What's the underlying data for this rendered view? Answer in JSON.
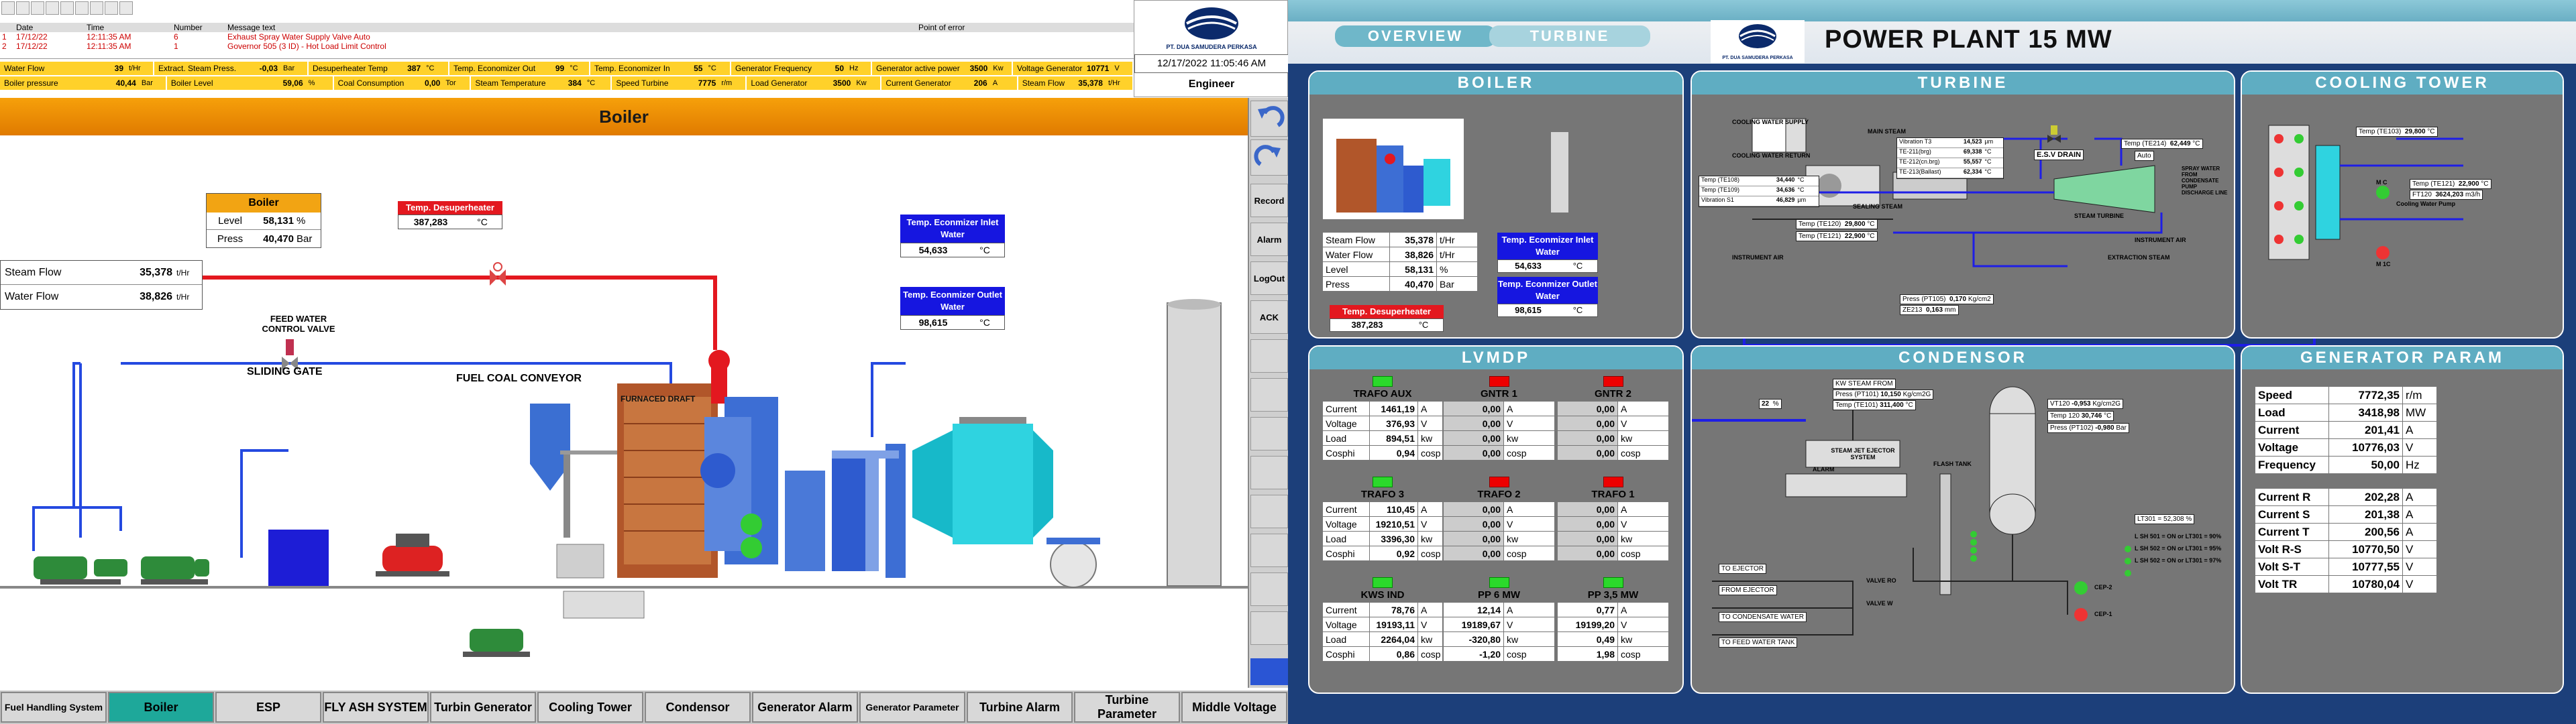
{
  "left": {
    "alarm_table": {
      "headers": [
        "",
        "Date",
        "Time",
        "Number",
        "Message text",
        "Point of error"
      ],
      "rows": [
        {
          "idx": "1",
          "date": "17/12/22",
          "time": "12:11:35 AM",
          "number": "6",
          "message": "Exhaust Spray Water Supply Valve Auto",
          "point": ""
        },
        {
          "idx": "2",
          "date": "17/12/22",
          "time": "12:11:35 AM",
          "number": "1",
          "message": "Governor 505 (3 ID) - Hot Load Limit Control",
          "point": ""
        }
      ]
    },
    "status_row1": [
      {
        "label": "Water Flow",
        "value": "39",
        "unit": "t/Hr"
      },
      {
        "label": "Extract. Steam Press.",
        "value": "-0,03",
        "unit": "Bar"
      },
      {
        "label": "Desuperheater Temp",
        "value": "387",
        "unit": "°C"
      },
      {
        "label": "Temp. Economizer Out",
        "value": "99",
        "unit": "°C"
      },
      {
        "label": "Temp. Economizer In",
        "value": "55",
        "unit": "°C"
      },
      {
        "label": "Generator Frequency",
        "value": "50",
        "unit": "Hz"
      },
      {
        "label": "Generator active power",
        "value": "3500",
        "unit": "Kw"
      },
      {
        "label": "Voltage Generator",
        "value": "10771",
        "unit": "V"
      }
    ],
    "status_row2": [
      {
        "label": "Boiler pressure",
        "value": "40,44",
        "unit": "Bar"
      },
      {
        "label": "Boiler Level",
        "value": "59,06",
        "unit": "%"
      },
      {
        "label": "Coal Consumption",
        "value": "0,00",
        "unit": "Tor"
      },
      {
        "label": "Steam Temperature",
        "value": "384",
        "unit": "°C"
      },
      {
        "label": "Speed Turbine",
        "value": "7775",
        "unit": "r/m"
      },
      {
        "label": "Load Generator",
        "value": "3500",
        "unit": "Kw"
      },
      {
        "label": "Current Generator",
        "value": "206",
        "unit": "A"
      },
      {
        "label": "Steam Flow",
        "value": "35,378",
        "unit": "t/Hr"
      }
    ],
    "datetime": "12/17/2022 11:05:46 AM",
    "user": "Engineer",
    "logo_caption": "PT. DUA SAMUDERA PERKASA",
    "page_title": "Boiler",
    "right_nav": [
      "Record",
      "Alarm",
      "LogOut",
      "ACK"
    ],
    "boiler_box": {
      "title": "Boiler",
      "level_label": "Level",
      "level_value": "58,131",
      "level_unit": "%",
      "press_label": "Press",
      "press_value": "40,470",
      "press_unit": "Bar"
    },
    "desuper": {
      "label": "Temp. Desuperheater",
      "value": "387,283",
      "unit": "°C"
    },
    "eco_in": {
      "label": "Temp. Econmizer Inlet Water",
      "value": "54,633",
      "unit": "°C"
    },
    "eco_out": {
      "label": "Temp. Econmizer Outlet Water",
      "value": "98,615",
      "unit": "°C"
    },
    "steam_flow": {
      "label": "Steam Flow",
      "value": "35,378",
      "unit": "t/Hr"
    },
    "water_flow": {
      "label": "Water Flow",
      "value": "38,826",
      "unit": "t/Hr"
    },
    "labels": {
      "feed_water": "FEED WATER CONTROL VALVE",
      "sliding_gate": "SLIDING GATE",
      "fuel_coal": "FUEL COAL CONVEYOR",
      "furnace": "FURNACED DRAFT"
    },
    "bottom_nav": [
      "Fuel Handling System",
      "Boiler",
      "ESP",
      "FLY ASH SYSTEM",
      "Turbin Generator",
      "Cooling Tower",
      "Condensor",
      "Generator Alarm",
      "Generator Parameter",
      "Turbine Alarm",
      "Turbine Parameter",
      "Middle Voltage"
    ]
  },
  "right": {
    "tabs": [
      "OVERVIEW",
      "TURBINE"
    ],
    "title": "POWER PLANT 15 MW",
    "logo_caption": "PT. DUA SAMUDERA PERKASA",
    "boiler": {
      "title": "BOILER",
      "rows": [
        {
          "label": "Steam Flow",
          "value": "35,378",
          "unit": "t/Hr"
        },
        {
          "label": "Water Flow",
          "value": "38,826",
          "unit": "t/Hr"
        },
        {
          "label": "Level",
          "value": "58,131",
          "unit": "%"
        },
        {
          "label": "Press",
          "value": "40,470",
          "unit": "Bar"
        }
      ],
      "eco_in": {
        "label": "Temp. Econmizer Inlet Water",
        "value": "54,633",
        "unit": "°C"
      },
      "eco_out": {
        "label": "Temp. Econmizer Outlet Water",
        "value": "98,615",
        "unit": "°C"
      },
      "desuper": {
        "label": "Temp. Desuperheater",
        "value": "387,283",
        "unit": "°C"
      }
    },
    "turbine": {
      "title": "TURBINE",
      "readouts": [
        {
          "label": "Vibration T3",
          "value": "14,523",
          "unit": "µm"
        },
        {
          "label": "TE-211(brg)",
          "value": "69,338",
          "unit": "°C"
        },
        {
          "label": "TE-212(cn.brg)",
          "value": "55,557",
          "unit": "°C"
        },
        {
          "label": "TE-213(Ballast)",
          "value": "62,334",
          "unit": "°C"
        }
      ],
      "left_temps": [
        {
          "label": "Temp (TE108)",
          "value": "34,440",
          "unit": "°C"
        },
        {
          "label": "Temp (TE109)",
          "value": "34,636",
          "unit": "°C"
        },
        {
          "label": "Vibration S1",
          "value": "46,829",
          "unit": "µm"
        }
      ],
      "te120": {
        "label": "Temp (TE120)",
        "value": "29,800",
        "unit": "°C"
      },
      "te121": {
        "label": "Temp (TE121)",
        "value": "22,900",
        "unit": "°C"
      },
      "te214": {
        "label": "Temp (TE214)",
        "value": "62,449",
        "unit": "°C"
      },
      "pt105": {
        "label": "Press (PT105)",
        "value": "0,170",
        "unit": "Kg/cm2"
      },
      "ze213": {
        "label": "ZE213",
        "value": "0,163",
        "unit": "mm"
      },
      "esv": "E.S.V DRAIN",
      "auto": "Auto",
      "labels": [
        "COOLING WATER SUPPLY",
        "COOLING WATER RETURN",
        "MAIN STEAM",
        "SEALING STEAM",
        "INSTRUMENT AIR",
        "STEAM TURBINE",
        "SPRAY WATER FROM CONDENSATE PUMP DISCHARGE LINE",
        "INSTRUMENT AIR",
        "EXTRACTION STEAM"
      ]
    },
    "cooling": {
      "title": "COOLING TOWER",
      "te103": {
        "label": "Temp (TE103)",
        "value": "29,800",
        "unit": "°C"
      },
      "te121": {
        "label": "Temp (TE121)",
        "value": "22,900",
        "unit": "°C"
      },
      "ft120": {
        "label": "FT120",
        "value": "3624,203",
        "unit": "m3/h"
      },
      "labels": [
        "M C",
        "Cooling Water Pump",
        "M 1C"
      ]
    },
    "lvmdp": {
      "title": "LVMDP",
      "groups": [
        {
          "name": "TRAFO AUX",
          "status": "green",
          "rows": [
            [
              "1461,19",
              "A"
            ],
            [
              "376,93",
              "V"
            ],
            [
              "894,51",
              "kw"
            ],
            [
              "0,94",
              "cosp"
            ]
          ]
        },
        {
          "name": "GNTR 1",
          "status": "red",
          "rows": [
            [
              "0,00",
              "A"
            ],
            [
              "0,00",
              "V"
            ],
            [
              "0,00",
              "kw"
            ],
            [
              "0,00",
              "cosp"
            ]
          ]
        },
        {
          "name": "GNTR 2",
          "status": "red",
          "rows": [
            [
              "0,00",
              "A"
            ],
            [
              "0,00",
              "V"
            ],
            [
              "0,00",
              "kw"
            ],
            [
              "0,00",
              "cosp"
            ]
          ]
        },
        {
          "name": "TRAFO 3",
          "status": "green",
          "rows": [
            [
              "110,45",
              "A"
            ],
            [
              "19210,51",
              "V"
            ],
            [
              "3396,30",
              "kw"
            ],
            [
              "0,92",
              "cosp"
            ]
          ]
        },
        {
          "name": "TRAFO 2",
          "status": "red",
          "rows": [
            [
              "0,00",
              "A"
            ],
            [
              "0,00",
              "V"
            ],
            [
              "0,00",
              "kw"
            ],
            [
              "0,00",
              "cosp"
            ]
          ]
        },
        {
          "name": "TRAFO 1",
          "status": "red",
          "rows": [
            [
              "0,00",
              "A"
            ],
            [
              "0,00",
              "V"
            ],
            [
              "0,00",
              "kw"
            ],
            [
              "0,00",
              "cosp"
            ]
          ]
        },
        {
          "name": "KWS IND",
          "status": "green",
          "rows": [
            [
              "78,76",
              "A"
            ],
            [
              "19193,11",
              "V"
            ],
            [
              "2264,04",
              "kw"
            ],
            [
              "0,86",
              "cosp"
            ]
          ]
        },
        {
          "name": "PP 6 MW",
          "status": "green",
          "rows": [
            [
              "12,14",
              "A"
            ],
            [
              "19189,67",
              "V"
            ],
            [
              "-320,80",
              "kw"
            ],
            [
              "-1,20",
              "cosp"
            ]
          ]
        },
        {
          "name": "PP 3,5 MW",
          "status": "green",
          "rows": [
            [
              "0,77",
              "A"
            ],
            [
              "19199,20",
              "V"
            ],
            [
              "0,49",
              "kw"
            ],
            [
              "1,98",
              "cosp"
            ]
          ]
        }
      ],
      "row_labels": [
        "Current",
        "Voltage",
        "Load",
        "Cosphi"
      ]
    },
    "condensor": {
      "title": "CONDENSOR",
      "pt101": {
        "label": "Press (PT101)",
        "value": "10,150",
        "unit": "Kg/cm2G"
      },
      "te101": {
        "label": "Temp (TE101)",
        "value": "311,400",
        "unit": "°C"
      },
      "level": "22",
      "level_unit": "%",
      "vt120": {
        "label": "VT120",
        "value": "-0,953",
        "unit": "Kg/cm2G"
      },
      "temp120": {
        "label": "Temp 120",
        "value": "30,746",
        "unit": "°C"
      },
      "pt102": {
        "label": "Press (PT102)",
        "value": "-0,980",
        "unit": "Bar"
      },
      "labels": [
        "KW STEAM FROM",
        "STEAM JET EJECTOR SYSTEM",
        "ALARM",
        "FLASH TANK",
        "CEP-2",
        "CEP-1",
        "VALVE RO",
        "VALVE W",
        "TO EJECTOR",
        "FROM EJECTOR",
        "TO CONDENSATE WATER",
        "TO FEED WATER TANK"
      ],
      "legend": [
        "L SH 501 = ON or LT301 = 90%",
        "L SH 502 = ON or LT301 = 95%",
        "L SH 502 = ON or LT301 = 97%"
      ],
      "lt_label": "LT301 = 52,308 %"
    },
    "generator": {
      "title": "GENERATOR PARAM",
      "rows1": [
        {
          "label": "Speed",
          "value": "7772,35",
          "unit": "r/m"
        },
        {
          "label": "Load",
          "value": "3418,98",
          "unit": "MW"
        },
        {
          "label": "Current",
          "value": "201,41",
          "unit": "A"
        },
        {
          "label": "Voltage",
          "value": "10776,03",
          "unit": "V"
        },
        {
          "label": "Frequency",
          "value": "50,00",
          "unit": "Hz"
        }
      ],
      "rows2": [
        {
          "label": "Current R",
          "value": "202,28",
          "unit": "A"
        },
        {
          "label": "Current S",
          "value": "201,38",
          "unit": "A"
        },
        {
          "label": "Current T",
          "value": "200,56",
          "unit": "A"
        },
        {
          "label": "Volt R-S",
          "value": "10770,50",
          "unit": "V"
        },
        {
          "label": "Volt S-T",
          "value": "10777,55",
          "unit": "V"
        },
        {
          "label": "Volt TR",
          "value": "10780,04",
          "unit": "V"
        }
      ]
    }
  }
}
